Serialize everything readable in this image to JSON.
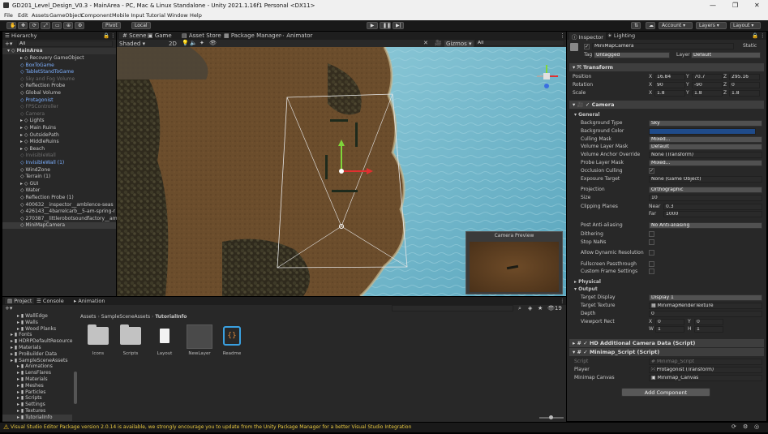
{
  "window": {
    "title": "GD201_Level_Design_V0.3 - MainArea - PC, Mac & Linux Standalone - Unity 2021.1.16f1 Personal <DX11>"
  },
  "menu": [
    "File",
    "Edit",
    "Assets",
    "GameObject",
    "Component",
    "Mobile Input",
    "Tutorial",
    "Window",
    "Help"
  ],
  "toolbar": {
    "pivot": "Pivot",
    "local": "Local",
    "account": "Account",
    "layers": "Layers",
    "layout": "Layout"
  },
  "hierarchy": {
    "tab": "Hierarchy",
    "search_placeholder": "All",
    "scene": "MainArea",
    "items": [
      {
        "label": "Recovery GameObject",
        "style": "normal"
      },
      {
        "label": "BoxToGame",
        "style": "blue"
      },
      {
        "label": "TabletStandToGame",
        "style": "blue"
      },
      {
        "label": "Sky and Fog Volume",
        "style": "dim"
      },
      {
        "label": "Reflection Probe",
        "style": "normal"
      },
      {
        "label": "Global Volume",
        "style": "normal"
      },
      {
        "label": "Protagonist",
        "style": "blue"
      },
      {
        "label": "FPSController",
        "style": "dim"
      },
      {
        "label": "Camera",
        "style": "dim"
      },
      {
        "label": "Lights",
        "style": "normal"
      },
      {
        "label": "Main Ruins",
        "style": "normal"
      },
      {
        "label": "OutsidePath",
        "style": "normal"
      },
      {
        "label": "MiddleRuins",
        "style": "normal"
      },
      {
        "label": "Beach",
        "style": "normal"
      },
      {
        "label": "InvisibleWall",
        "style": "dim"
      },
      {
        "label": "InvisibleWall (1)",
        "style": "blue"
      },
      {
        "label": "WindZone",
        "style": "normal"
      },
      {
        "label": "Terrain (1)",
        "style": "normal"
      },
      {
        "label": "GUI",
        "style": "normal"
      },
      {
        "label": "Water",
        "style": "normal"
      },
      {
        "label": "Reflection Probe (1)",
        "style": "normal"
      },
      {
        "label": "400632__inspector__amblence-seas",
        "style": "normal"
      },
      {
        "label": "426143__4barrelcarb__5-am-spring-r",
        "style": "normal"
      },
      {
        "label": "270387__littlerobotsoundfactory__am",
        "style": "normal"
      },
      {
        "label": "MiniMapCamera",
        "style": "selected"
      }
    ]
  },
  "scene": {
    "tabs": [
      "Scene",
      "Game",
      "Asset Store",
      "Package Manager",
      "Animator"
    ],
    "shading": "Shaded",
    "mode2d": "2D",
    "gizmos": "Gizmos",
    "search_placeholder": "All",
    "camera_preview_title": "Camera Preview"
  },
  "inspector": {
    "tabs": [
      "Inspector",
      "Lighting"
    ],
    "object_name": "MiniMapCamera",
    "static_label": "Static",
    "tag_label": "Tag",
    "tag_value": "Untagged",
    "layer_label": "Layer",
    "layer_value": "Default",
    "transform": {
      "title": "Transform",
      "position": {
        "label": "Position",
        "x": "16.84",
        "y": "70.7",
        "z": "295.16"
      },
      "rotation": {
        "label": "Rotation",
        "x": "90",
        "y": "-90",
        "z": "0"
      },
      "scale": {
        "label": "Scale",
        "x": "1.8",
        "y": "1.8",
        "z": "1.8"
      }
    },
    "camera": {
      "title": "Camera",
      "general": "General",
      "rows": [
        {
          "label": "Background Type",
          "value": "Sky",
          "kind": "dropdown"
        },
        {
          "label": "Background Color",
          "value": "",
          "kind": "color"
        },
        {
          "label": "Culling Mask",
          "value": "Mixed...",
          "kind": "dropdown"
        },
        {
          "label": "Volume Layer Mask",
          "value": "Default",
          "kind": "dropdown"
        },
        {
          "label": "Volume Anchor Override",
          "value": "None (Transform)",
          "kind": "object"
        },
        {
          "label": "Probe Layer Mask",
          "value": "Mixed...",
          "kind": "dropdown"
        },
        {
          "label": "Occlusion Culling",
          "value": "✓",
          "kind": "check"
        },
        {
          "label": "Exposure Target",
          "value": "None (Game Object)",
          "kind": "object"
        }
      ],
      "projection_label": "Projection",
      "projection_value": "Orthographic",
      "size_label": "Size",
      "size_value": "10",
      "clipping_label": "Clipping Planes",
      "near_label": "Near",
      "near_value": "0.3",
      "far_label": "Far",
      "far_value": "1000",
      "post_aa_label": "Post Anti-aliasing",
      "post_aa_value": "No Anti-aliasing",
      "dithering_label": "Dithering",
      "stop_nans_label": "Stop NaNs",
      "allow_dynres_label": "Allow Dynamic Resolution",
      "fullscreen_label": "Fullscreen Passthrough",
      "custom_frame_label": "Custom Frame Settings",
      "physical_label": "Physical",
      "output_label": "Output",
      "target_display_label": "Target Display",
      "target_display_value": "Display 1",
      "target_texture_label": "Target Texture",
      "target_texture_value": "MinimapRenderTexture",
      "depth_label": "Depth",
      "depth_value": "0",
      "viewport_label": "Viewport Rect",
      "vp_x": "0",
      "vp_y": "0",
      "vp_w": "1",
      "vp_h": "1"
    },
    "hd_camera_title": "HD Additional Camera Data (Script)",
    "minimap_script": {
      "title": "Minimap_Script (Script)",
      "script_label": "Script",
      "script_value": "Minimap_Script",
      "player_label": "Player",
      "player_value": "Protagonist (Transform)",
      "canvas_label": "Minimap Canvas",
      "canvas_value": "Minimap_Canvas"
    },
    "add_component": "Add Component"
  },
  "project": {
    "tabs": [
      "Project",
      "Console",
      "Animation"
    ],
    "tree": [
      "WallEdge",
      "Walls",
      "Wood Planks",
      "Fonts",
      "HDRPDefaultResource",
      "Materials",
      "ProBuilder Data",
      "SampleSceneAssets",
      "Animations",
      "LensFlares",
      "Materials",
      "Meshes",
      "Particles",
      "Scripts",
      "Settings",
      "Textures",
      "TutorialInfo"
    ],
    "breadcrumb": [
      "Assets",
      "SampleSceneAssets",
      "TutorialInfo"
    ],
    "assets": [
      "Icons",
      "Scripts",
      "Layout",
      "NewLayer",
      "Readme"
    ],
    "count": "19"
  },
  "status": {
    "message": "Visual Studio Editor Package version 2.0.14 is available, we strongly encourage you to update from the Unity Package Manager for a better Visual Studio Integration"
  }
}
